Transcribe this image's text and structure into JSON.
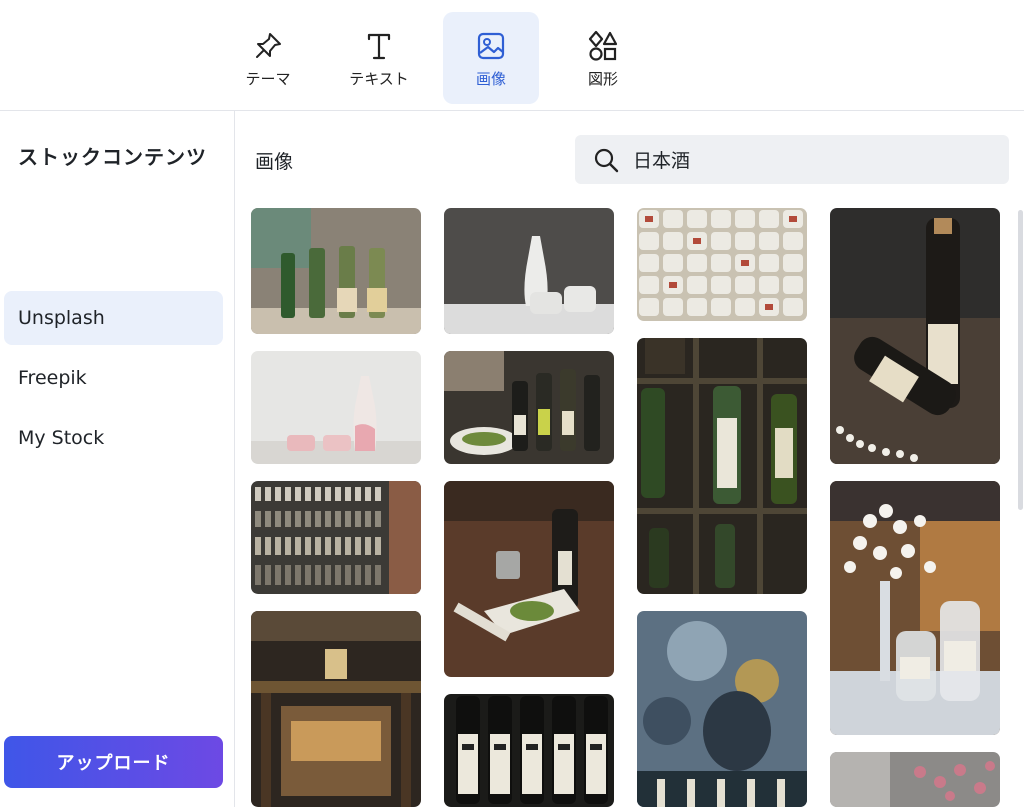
{
  "toolbar": {
    "items": [
      {
        "label": "テーマ",
        "icon": "pin-icon"
      },
      {
        "label": "テキスト",
        "icon": "text-t-icon"
      },
      {
        "label": "画像",
        "icon": "image-icon",
        "active": true
      },
      {
        "label": "図形",
        "icon": "shapes-icon"
      }
    ]
  },
  "sidebar": {
    "title": "ストックコンテンツ",
    "sources": [
      {
        "label": "Unsplash",
        "active": true
      },
      {
        "label": "Freepik"
      },
      {
        "label": "My Stock"
      }
    ],
    "upload_label": "アップロード"
  },
  "main": {
    "section_title": "画像",
    "search": {
      "value": "日本酒",
      "icon": "search-icon"
    }
  },
  "colors": {
    "accent": "#2f5fd4",
    "active_bg": "#eaf0fb",
    "upload_gradient_start": "#3f56e8",
    "upload_gradient_end": "#6d49e4"
  },
  "gallery": {
    "columns": [
      [
        "sake bottles on wooden table",
        "white tokkuri and ochoko cups",
        "wall of sake bottles",
        "sake bar entrance with lantern"
      ],
      [
        "white sake flask with cups",
        "sake bottles with food",
        "sake bottle with dish on table",
        "row of sake bottles with labels"
      ],
      [
        "stacked sake barrels (komodaru)",
        "sake bottles behind glass cabinet",
        "blurred bar interior"
      ],
      [
        "dark sake bottles on table",
        "sake bottles with white flowers",
        "pink blossoms"
      ]
    ]
  }
}
